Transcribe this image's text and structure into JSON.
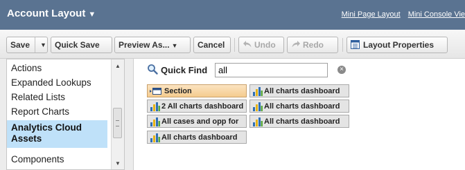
{
  "header": {
    "title": "Account Layout",
    "title_caret": "▼",
    "links": [
      "Mini Page Layout",
      "Mini Console View"
    ]
  },
  "toolbar": {
    "save_label": "Save",
    "save_menu": "▼",
    "quick_save_label": "Quick Save",
    "preview_label": "Preview As...",
    "preview_menu": "▼",
    "cancel_label": "Cancel",
    "undo_label": "Undo",
    "redo_label": "Redo",
    "layout_properties_label": "Layout Properties"
  },
  "categories": {
    "items": [
      {
        "label": "Actions"
      },
      {
        "label": "Expanded Lookups"
      },
      {
        "label": "Related Lists"
      },
      {
        "label": "Report Charts"
      },
      {
        "label": "Analytics Cloud Assets",
        "selected": true
      },
      {
        "label": "Components"
      }
    ],
    "scroll_up": "▲",
    "scroll_down": "▼"
  },
  "quick_find": {
    "label": "Quick Find",
    "value": "all",
    "clear_glyph": "×"
  },
  "palette": {
    "items": [
      {
        "label": "Section",
        "icon": "section-icon"
      },
      {
        "label": "All charts dashboard",
        "icon": "chart-icon"
      },
      {
        "label": "2 All charts dashboard",
        "icon": "chart-icon"
      },
      {
        "label": "All charts dashboard",
        "icon": "chart-icon"
      },
      {
        "label": "All cases and opp for",
        "icon": "chart-icon"
      },
      {
        "label": "All charts dashboard",
        "icon": "chart-icon"
      },
      {
        "label": "All charts dashboard",
        "icon": "chart-icon"
      }
    ]
  },
  "colors": {
    "header_bg": "#5a7391",
    "selected_bg": "#bfe1f9",
    "section_tile": "#f5cc8f",
    "chart_blue": "#2f6fb5",
    "chart_yellow": "#e5b417",
    "chart_green": "#5aa83c"
  }
}
